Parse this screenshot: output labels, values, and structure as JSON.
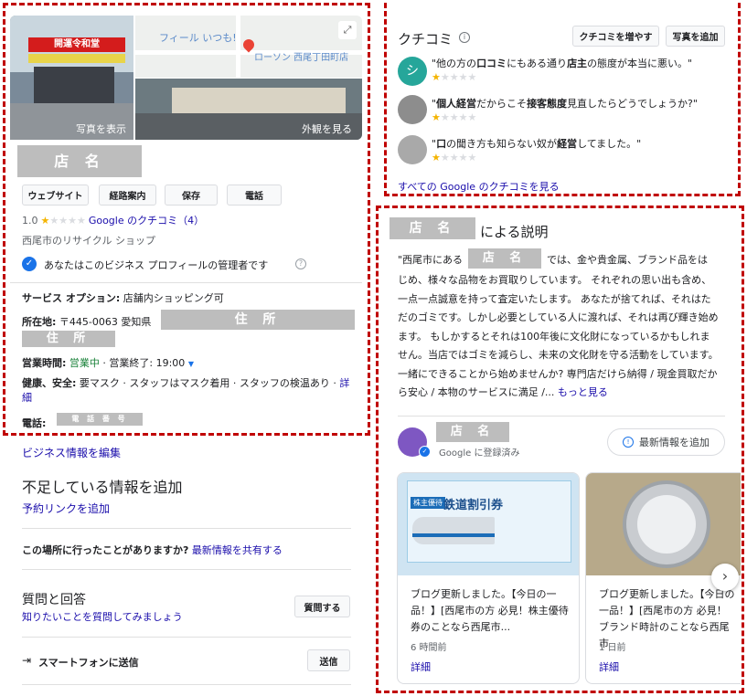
{
  "left": {
    "photos": {
      "storefront_sign": "開運令和堂",
      "map_text_1": "フィール いつも!",
      "map_text_2": "ローソン 西尾丁田町店",
      "view_photos_label": "写真を表示",
      "view_exterior_label": "外観を見る"
    },
    "shop_name": "店 名",
    "buttons": {
      "website": "ウェブサイト",
      "directions": "経路案内",
      "save": "保存",
      "call": "電話"
    },
    "rating": {
      "value": "1.0",
      "stars": 1,
      "reviews_link": "Google のクチコミ（4）"
    },
    "category": "西尾市のリサイクル ショップ",
    "manager_text": "あなたはこのビジネス プロフィールの管理者です",
    "service_label": "サービス オプション:",
    "service_value": "店舗内ショッピング可",
    "address_label": "所在地:",
    "address_value": "〒445-0063 愛知県",
    "address_masked_1": "住 所",
    "address_masked_2": "住 所",
    "hours_label": "営業時間:",
    "hours_open": "営業中",
    "hours_close": "· 営業終了: 19:00",
    "health_label": "健康、安全:",
    "health_value": "要マスク · スタッフはマスク着用 · スタッフの検温あり ·",
    "health_more": "詳細",
    "phone_label": "電話:",
    "phone_masked": "電 話 番 号",
    "edit_info": "ビジネス情報を編集",
    "missing_title": "不足している情報を追加",
    "add_reservation": "予約リンクを追加",
    "visited_q": "この場所に行ったことがありますか?",
    "share_update": "最新情報を共有する",
    "qa_title": "質問と回答",
    "qa_sub": "知りたいことを質問してみましょう",
    "ask_button": "質問する",
    "send_phone": "スマートフォンに送信",
    "send_button": "送信"
  },
  "right": {
    "reviews_title": "クチコミ",
    "more_reviews_button": "クチコミを増やす",
    "add_photo_button": "写真を追加",
    "reviews": [
      {
        "avatar_letter": "シ",
        "text_pre": "\"他の方の",
        "b1": "口コミ",
        "text_mid": "にもある通り",
        "b2": "店主",
        "text_post": "の態度が本当に悪い。\"",
        "stars": 1
      },
      {
        "text_pre": "\"",
        "b1": "個人経営",
        "text_mid": "だからこそ",
        "b2": "接客態度",
        "text_post": "見直したらどうでしょうか?\"",
        "stars": 1
      },
      {
        "text_pre": "\"",
        "b1": "口",
        "text_mid": "の聞き方も知らない奴が",
        "b2": "経営",
        "text_post": "してました。\"",
        "stars": 1
      }
    ],
    "all_reviews_link": "すべての Google のクチコミを見る",
    "desc_name": "店 名",
    "desc_suffix": "による説明",
    "desc_line1_pre": "\"西尾市にある",
    "desc_line1_name": "店 名",
    "desc_line1_post": "では、金や貴金属、ブランド品をは",
    "desc_rest": "じめ、様々な品物をお買取りしています。 それぞれの思い出も含め、一点一点誠意を持って査定いたします。 あなたが捨てれば、それはただのゴミです。しかし必要としている人に渡れば、それは再び輝き始めます。 もしかするとそれは100年後に文化財になっているかもしれません。当店ではゴミを減らし、未来の文化財を守る活動をしています。 一緒にできることから始めませんか? 専門店だけら納得 / 現金買取だから安心 / 本物のサービスに満足 /...",
    "desc_more": "もっと見る",
    "owner_name": "店 名",
    "owner_sub": "Google に登録済み",
    "add_update_button": "最新情報を追加",
    "posts": [
      {
        "img_title": "鉄道割引券",
        "img_sub": "株主優待",
        "text": "ブログ更新しました。【今日の一品！】[西尾市の方 必見！株主優待券のことなら西尾市...",
        "time": "6 時間前",
        "more": "詳細"
      },
      {
        "img_title": "",
        "text": "ブログ更新しました。【今日の一品！】[西尾市の方 必見！ブランド時計のことなら西尾市",
        "time": "1 日前",
        "more": "詳細"
      }
    ]
  }
}
